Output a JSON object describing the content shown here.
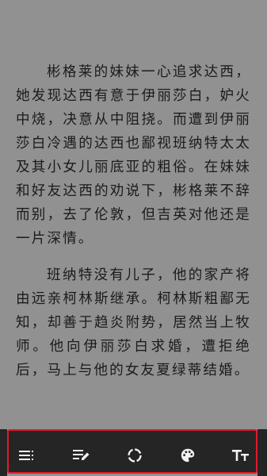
{
  "reader": {
    "paragraphs": [
      "彬格莱的妹妹一心追求达西，她发现达西有意于伊丽莎白，妒火中烧，决意从中阻挠。而遭到伊丽莎白冷遇的达西也鄙视班纳特太太及其小女儿丽底亚的粗俗。在妹妹和好友达西的劝说下，彬格莱不辞而别，去了伦敦，但吉英对他还是一片深情。",
      "班纳特没有儿子，他的家产将由远亲柯林斯继承。柯林斯粗鄙无知，却善于趋炎附势，居然当上牧师。他向伊丽莎白求婚，遭拒绝后，马上与他的女友夏绿蒂结婚。"
    ]
  },
  "toolbar": {
    "buttons": [
      {
        "icon": "list-menu-icon"
      },
      {
        "icon": "edit-note-icon"
      },
      {
        "icon": "progress-ring-icon"
      },
      {
        "icon": "palette-icon"
      },
      {
        "icon": "text-size-icon"
      }
    ],
    "border_color": "#e3192b",
    "background": "#252526",
    "icon_color": "#f2f2f2"
  },
  "colors": {
    "page_background": "#919191",
    "text": "#1b1b1b"
  }
}
